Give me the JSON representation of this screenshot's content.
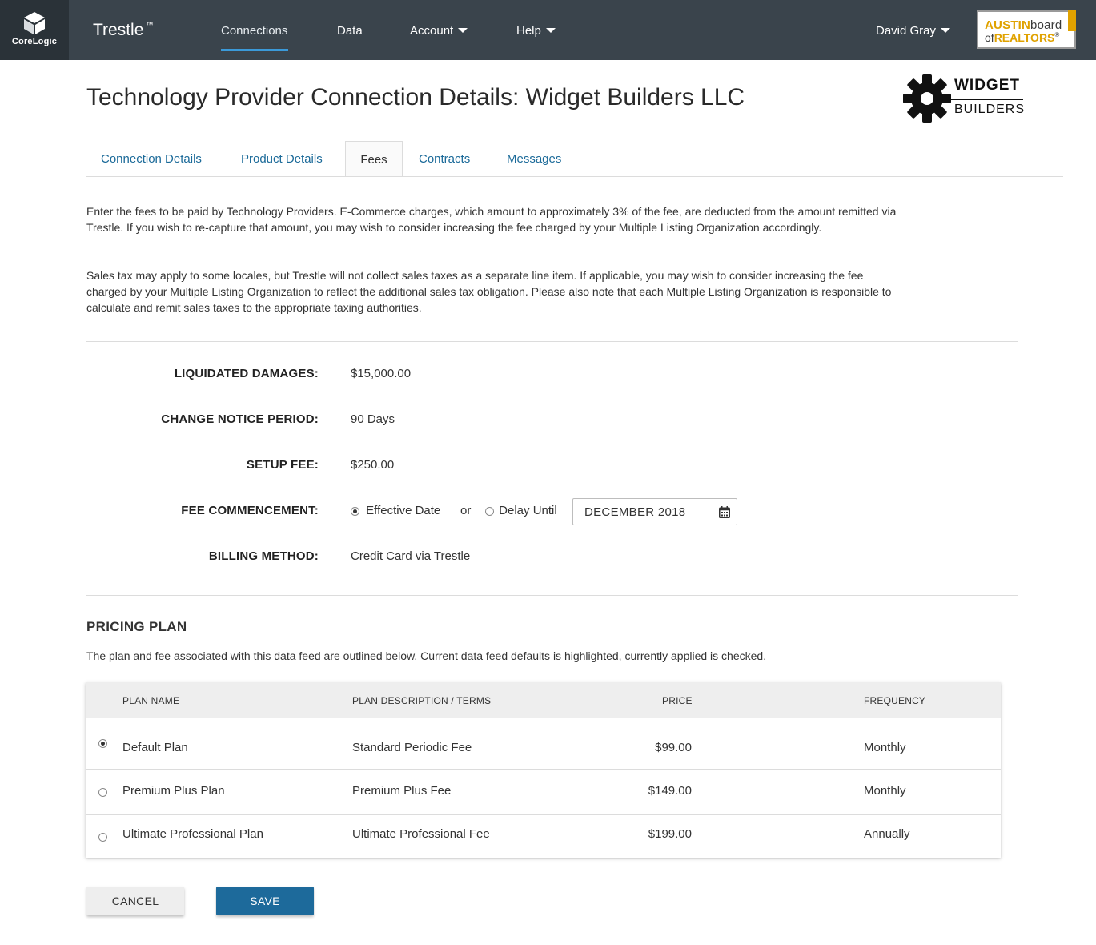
{
  "header": {
    "corelogic_label": "CoreLogic",
    "brand": "Trestle",
    "brand_tm": "™",
    "nav": [
      {
        "label": "Connections"
      },
      {
        "label": "Data"
      },
      {
        "label": "Account"
      },
      {
        "label": "Help"
      }
    ],
    "user": "David Gray",
    "partner_logo": {
      "line1a": "AUSTIN",
      "line1b": "board",
      "line2a": "of",
      "line2b": "REALTORS",
      "line2c": "®"
    }
  },
  "page": {
    "title": "Technology Provider Connection Details: Widget Builders LLC",
    "logo": {
      "line1": "WIDGET",
      "line2": "BUILDERS"
    }
  },
  "tabs": [
    {
      "label": "Connection Details"
    },
    {
      "label": "Product Details"
    },
    {
      "label": "Fees"
    },
    {
      "label": "Contracts"
    },
    {
      "label": "Messages"
    }
  ],
  "intro": {
    "p1": "Enter the fees to be paid by Technology Providers. E-Commerce charges, which amount to approximately 3% of the fee, are deducted from the amount remitted via Trestle. If you wish to re-capture that amount, you may wish to consider increasing the fee charged by your Multiple Listing Organization accordingly.",
    "p2": "Sales tax may apply to some locales, but Trestle will not collect sales taxes as a separate line item. If applicable, you may wish to consider increasing the fee charged by your Multiple Listing Organization to reflect the additional sales tax obligation. Please also note that each Multiple Listing Organization is responsible to calculate and remit sales taxes to the appropriate taxing authorities."
  },
  "fields": {
    "liquidated_damages": {
      "label": "LIQUIDATED DAMAGES:",
      "value": "$15,000.00"
    },
    "change_notice": {
      "label": "CHANGE NOTICE PERIOD:",
      "value": "90 Days"
    },
    "setup_fee": {
      "label": "SETUP FEE:",
      "value": "$250.00"
    },
    "fee_commencement": {
      "label": "FEE COMMENCEMENT:",
      "option1": "Effective Date",
      "or": "or",
      "option2": "Delay Until",
      "date": "DECEMBER 2018",
      "selected": "Effective Date"
    },
    "billing_method": {
      "label": "BILLING METHOD:",
      "value": "Credit Card via Trestle"
    }
  },
  "pricing": {
    "title": "PRICING PLAN",
    "description": "The plan and fee associated with this data feed are outlined below. Current data feed defaults is highlighted, currently applied is checked.",
    "columns": {
      "name": "PLAN NAME",
      "desc": "PLAN DESCRIPTION / TERMS",
      "price": "PRICE",
      "freq": "FREQUENCY"
    },
    "rows": [
      {
        "name": "Default Plan",
        "desc": "Standard Periodic Fee",
        "price": "$99.00",
        "freq": "Monthly",
        "selected": true
      },
      {
        "name": "Premium Plus Plan",
        "desc": "Premium Plus Fee",
        "price": "$149.00",
        "freq": "Monthly",
        "selected": false
      },
      {
        "name": "Ultimate Professional Plan",
        "desc": "Ultimate Professional Fee",
        "price": "$199.00",
        "freq": "Annually",
        "selected": false
      }
    ]
  },
  "actions": {
    "cancel": "CANCEL",
    "save": "SAVE"
  }
}
